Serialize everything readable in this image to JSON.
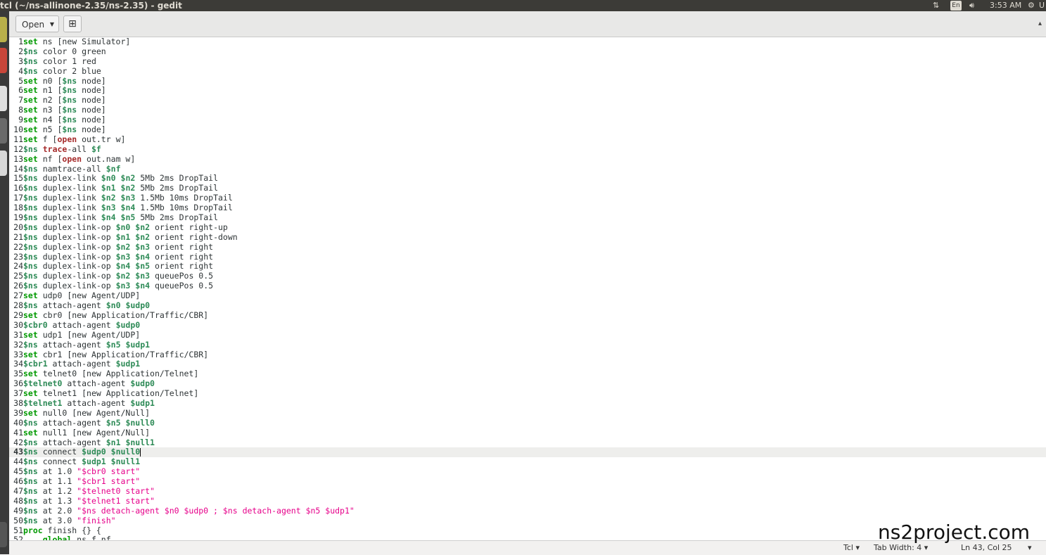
{
  "window": {
    "title": "tcl (~/ns-allinone-2.35/ns-2.35) - gedit",
    "indicators": {
      "keyboard": "En",
      "clock": "3:53 AM",
      "user": "U"
    }
  },
  "toolbar": {
    "open_label": "Open"
  },
  "editor": {
    "current_line": 43,
    "lines": [
      [
        [
          "k",
          "set"
        ],
        [
          "t",
          " ns [new Simulator]"
        ]
      ],
      [
        [
          "v",
          "$ns"
        ],
        [
          "t",
          " color 0 green"
        ]
      ],
      [
        [
          "v",
          "$ns"
        ],
        [
          "t",
          " color 1 red"
        ]
      ],
      [
        [
          "v",
          "$ns"
        ],
        [
          "t",
          " color 2 blue"
        ]
      ],
      [
        [
          "k",
          "set"
        ],
        [
          "t",
          " n0 ["
        ],
        [
          "v",
          "$ns"
        ],
        [
          "t",
          " node]"
        ]
      ],
      [
        [
          "k",
          "set"
        ],
        [
          "t",
          " n1 ["
        ],
        [
          "v",
          "$ns"
        ],
        [
          "t",
          " node]"
        ]
      ],
      [
        [
          "k",
          "set"
        ],
        [
          "t",
          " n2 ["
        ],
        [
          "v",
          "$ns"
        ],
        [
          "t",
          " node]"
        ]
      ],
      [
        [
          "k",
          "set"
        ],
        [
          "t",
          " n3 ["
        ],
        [
          "v",
          "$ns"
        ],
        [
          "t",
          " node]"
        ]
      ],
      [
        [
          "k",
          "set"
        ],
        [
          "t",
          " n4 ["
        ],
        [
          "v",
          "$ns"
        ],
        [
          "t",
          " node]"
        ]
      ],
      [
        [
          "k",
          "set"
        ],
        [
          "t",
          " n5 ["
        ],
        [
          "v",
          "$ns"
        ],
        [
          "t",
          " node]"
        ]
      ],
      [
        [
          "k",
          "set"
        ],
        [
          "t",
          " f ["
        ],
        [
          "r",
          "open"
        ],
        [
          "t",
          " out.tr w]"
        ]
      ],
      [
        [
          "v",
          "$ns"
        ],
        [
          "t",
          " "
        ],
        [
          "r",
          "trace"
        ],
        [
          "t",
          "-all "
        ],
        [
          "v",
          "$f"
        ]
      ],
      [
        [
          "k",
          "set"
        ],
        [
          "t",
          " nf ["
        ],
        [
          "r",
          "open"
        ],
        [
          "t",
          " out.nam w]"
        ]
      ],
      [
        [
          "v",
          "$ns"
        ],
        [
          "t",
          " namtrace-all "
        ],
        [
          "v",
          "$nf"
        ]
      ],
      [
        [
          "v",
          "$ns"
        ],
        [
          "t",
          " duplex-link "
        ],
        [
          "v",
          "$n0"
        ],
        [
          "t",
          " "
        ],
        [
          "v",
          "$n2"
        ],
        [
          "t",
          " 5Mb 2ms DropTail"
        ]
      ],
      [
        [
          "v",
          "$ns"
        ],
        [
          "t",
          " duplex-link "
        ],
        [
          "v",
          "$n1"
        ],
        [
          "t",
          " "
        ],
        [
          "v",
          "$n2"
        ],
        [
          "t",
          " 5Mb 2ms DropTail"
        ]
      ],
      [
        [
          "v",
          "$ns"
        ],
        [
          "t",
          " duplex-link "
        ],
        [
          "v",
          "$n2"
        ],
        [
          "t",
          " "
        ],
        [
          "v",
          "$n3"
        ],
        [
          "t",
          " 1.5Mb 10ms DropTail"
        ]
      ],
      [
        [
          "v",
          "$ns"
        ],
        [
          "t",
          " duplex-link "
        ],
        [
          "v",
          "$n3"
        ],
        [
          "t",
          " "
        ],
        [
          "v",
          "$n4"
        ],
        [
          "t",
          " 1.5Mb 10ms DropTail"
        ]
      ],
      [
        [
          "v",
          "$ns"
        ],
        [
          "t",
          " duplex-link "
        ],
        [
          "v",
          "$n4"
        ],
        [
          "t",
          " "
        ],
        [
          "v",
          "$n5"
        ],
        [
          "t",
          " 5Mb 2ms DropTail"
        ]
      ],
      [
        [
          "v",
          "$ns"
        ],
        [
          "t",
          " duplex-link-op "
        ],
        [
          "v",
          "$n0"
        ],
        [
          "t",
          " "
        ],
        [
          "v",
          "$n2"
        ],
        [
          "t",
          " orient right-up"
        ]
      ],
      [
        [
          "v",
          "$ns"
        ],
        [
          "t",
          " duplex-link-op "
        ],
        [
          "v",
          "$n1"
        ],
        [
          "t",
          " "
        ],
        [
          "v",
          "$n2"
        ],
        [
          "t",
          " orient right-down"
        ]
      ],
      [
        [
          "v",
          "$ns"
        ],
        [
          "t",
          " duplex-link-op "
        ],
        [
          "v",
          "$n2"
        ],
        [
          "t",
          " "
        ],
        [
          "v",
          "$n3"
        ],
        [
          "t",
          " orient right"
        ]
      ],
      [
        [
          "v",
          "$ns"
        ],
        [
          "t",
          " duplex-link-op "
        ],
        [
          "v",
          "$n3"
        ],
        [
          "t",
          " "
        ],
        [
          "v",
          "$n4"
        ],
        [
          "t",
          " orient right"
        ]
      ],
      [
        [
          "v",
          "$ns"
        ],
        [
          "t",
          " duplex-link-op "
        ],
        [
          "v",
          "$n4"
        ],
        [
          "t",
          " "
        ],
        [
          "v",
          "$n5"
        ],
        [
          "t",
          " orient right"
        ]
      ],
      [
        [
          "v",
          "$ns"
        ],
        [
          "t",
          " duplex-link-op "
        ],
        [
          "v",
          "$n2"
        ],
        [
          "t",
          " "
        ],
        [
          "v",
          "$n3"
        ],
        [
          "t",
          " queuePos 0.5"
        ]
      ],
      [
        [
          "v",
          "$ns"
        ],
        [
          "t",
          " duplex-link-op "
        ],
        [
          "v",
          "$n3"
        ],
        [
          "t",
          " "
        ],
        [
          "v",
          "$n4"
        ],
        [
          "t",
          " queuePos 0.5"
        ]
      ],
      [
        [
          "k",
          "set"
        ],
        [
          "t",
          " udp0 [new Agent/UDP]"
        ]
      ],
      [
        [
          "v",
          "$ns"
        ],
        [
          "t",
          " attach-agent "
        ],
        [
          "v",
          "$n0"
        ],
        [
          "t",
          " "
        ],
        [
          "v",
          "$udp0"
        ]
      ],
      [
        [
          "k",
          "set"
        ],
        [
          "t",
          " cbr0 [new Application/Traffic/CBR]"
        ]
      ],
      [
        [
          "v",
          "$cbr0"
        ],
        [
          "t",
          " attach-agent "
        ],
        [
          "v",
          "$udp0"
        ]
      ],
      [
        [
          "k",
          "set"
        ],
        [
          "t",
          " udp1 [new Agent/UDP]"
        ]
      ],
      [
        [
          "v",
          "$ns"
        ],
        [
          "t",
          " attach-agent "
        ],
        [
          "v",
          "$n5"
        ],
        [
          "t",
          " "
        ],
        [
          "v",
          "$udp1"
        ]
      ],
      [
        [
          "k",
          "set"
        ],
        [
          "t",
          " cbr1 [new Application/Traffic/CBR]"
        ]
      ],
      [
        [
          "v",
          "$cbr1"
        ],
        [
          "t",
          " attach-agent "
        ],
        [
          "v",
          "$udp1"
        ]
      ],
      [
        [
          "k",
          "set"
        ],
        [
          "t",
          " telnet0 [new Application/Telnet]"
        ]
      ],
      [
        [
          "v",
          "$telnet0"
        ],
        [
          "t",
          " attach-agent "
        ],
        [
          "v",
          "$udp0"
        ]
      ],
      [
        [
          "k",
          "set"
        ],
        [
          "t",
          " telnet1 [new Application/Telnet]"
        ]
      ],
      [
        [
          "v",
          "$telnet1"
        ],
        [
          "t",
          " attach-agent "
        ],
        [
          "v",
          "$udp1"
        ]
      ],
      [
        [
          "k",
          "set"
        ],
        [
          "t",
          " null0 [new Agent/Null]"
        ]
      ],
      [
        [
          "v",
          "$ns"
        ],
        [
          "t",
          " attach-agent "
        ],
        [
          "v",
          "$n5"
        ],
        [
          "t",
          " "
        ],
        [
          "v",
          "$null0"
        ]
      ],
      [
        [
          "k",
          "set"
        ],
        [
          "t",
          " null1 [new Agent/Null]"
        ]
      ],
      [
        [
          "v",
          "$ns"
        ],
        [
          "t",
          " attach-agent "
        ],
        [
          "v",
          "$n1"
        ],
        [
          "t",
          " "
        ],
        [
          "v",
          "$null1"
        ]
      ],
      [
        [
          "v",
          "$ns"
        ],
        [
          "t",
          " connect "
        ],
        [
          "v",
          "$udp0"
        ],
        [
          "t",
          " "
        ],
        [
          "v",
          "$null0"
        ]
      ],
      [
        [
          "v",
          "$ns"
        ],
        [
          "t",
          " connect "
        ],
        [
          "v",
          "$udp1"
        ],
        [
          "t",
          " "
        ],
        [
          "v",
          "$null1"
        ]
      ],
      [
        [
          "v",
          "$ns"
        ],
        [
          "t",
          " at 1.0 "
        ],
        [
          "s",
          "\"$cbr0 start\""
        ]
      ],
      [
        [
          "v",
          "$ns"
        ],
        [
          "t",
          " at 1.1 "
        ],
        [
          "s",
          "\"$cbr1 start\""
        ]
      ],
      [
        [
          "v",
          "$ns"
        ],
        [
          "t",
          " at 1.2 "
        ],
        [
          "s",
          "\"$telnet0 start\""
        ]
      ],
      [
        [
          "v",
          "$ns"
        ],
        [
          "t",
          " at 1.3 "
        ],
        [
          "s",
          "\"$telnet1 start\""
        ]
      ],
      [
        [
          "v",
          "$ns"
        ],
        [
          "t",
          " at 2.0 "
        ],
        [
          "s",
          "\"$ns detach-agent $n0 $udp0 ; $ns detach-agent $n5 $udp1\""
        ]
      ],
      [
        [
          "v",
          "$ns"
        ],
        [
          "t",
          " at 3.0 "
        ],
        [
          "s",
          "\"finish\""
        ]
      ],
      [
        [
          "k",
          "proc"
        ],
        [
          "t",
          " finish {} {"
        ]
      ],
      [
        [
          "t",
          "    "
        ],
        [
          "k",
          "global"
        ],
        [
          "t",
          " ns f nf"
        ]
      ]
    ]
  },
  "statusbar": {
    "language": "Tcl",
    "tab_width": "Tab Width: 4",
    "position": "Ln 43, Col 25"
  },
  "watermark": "ns2project.com"
}
